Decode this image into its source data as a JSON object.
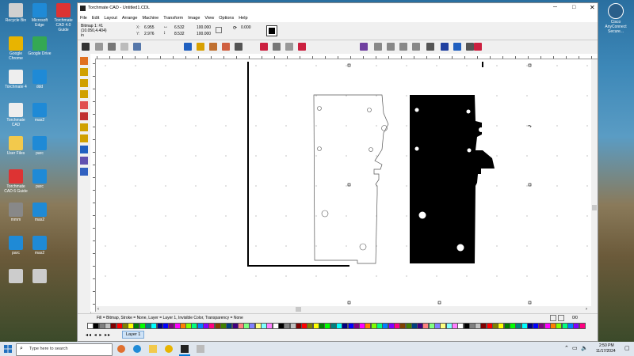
{
  "desktop": {
    "icons": [
      {
        "label": "Recycle Bin",
        "color": "#d0d0d0",
        "col": 0,
        "row": 0
      },
      {
        "label": "Microsoft Edge",
        "color": "#1f8ad6",
        "col": 1,
        "row": 0
      },
      {
        "label": "Torchmate CAD 4.0 Guide",
        "color": "#d33",
        "col": 2,
        "row": 0
      },
      {
        "label": "Google Chrome",
        "color": "#e8b400",
        "col": 0,
        "row": 1
      },
      {
        "label": "Google Drive",
        "color": "#34a853",
        "col": 1,
        "row": 1
      },
      {
        "label": "Torchmate 4",
        "color": "#eee",
        "col": 0,
        "row": 2
      },
      {
        "label": "ddd",
        "color": "#1f8ad6",
        "col": 1,
        "row": 2
      },
      {
        "label": "Torchmate CAD",
        "color": "#eee",
        "col": 0,
        "row": 3
      },
      {
        "label": "mas2",
        "color": "#1f8ad6",
        "col": 1,
        "row": 3
      },
      {
        "label": "User Files",
        "color": "#f2c94c",
        "col": 0,
        "row": 4
      },
      {
        "label": "parc",
        "color": "#1f8ad6",
        "col": 1,
        "row": 4
      },
      {
        "label": "Torchmate CAD 6 Guide",
        "color": "#d33",
        "col": 0,
        "row": 5
      },
      {
        "label": "parc",
        "color": "#1f8ad6",
        "col": 1,
        "row": 5
      },
      {
        "label": "mmm",
        "color": "#888",
        "col": 0,
        "row": 6
      },
      {
        "label": "mas2",
        "color": "#1f8ad6",
        "col": 1,
        "row": 6
      },
      {
        "label": "parc",
        "color": "#1f8ad6",
        "col": 0,
        "row": 7
      },
      {
        "label": "mas2",
        "color": "#1f8ad6",
        "col": 1,
        "row": 7
      },
      {
        "label": "",
        "color": "#ccc",
        "col": 0,
        "row": 8
      },
      {
        "label": "",
        "color": "#ccc",
        "col": 1,
        "row": 8
      }
    ],
    "right_icon_label": "Cisco AnyConnect Secure..."
  },
  "window": {
    "title": "Torchmate CAD - Untitled1.CDL",
    "menu": [
      "File",
      "Edit",
      "Layout",
      "Arrange",
      "Machine",
      "Transform",
      "Image",
      "View",
      "Options",
      "Help"
    ],
    "props": {
      "object": "Bitmap 1: #1",
      "size_readout": "(10.050,4.404)",
      "unit": "in",
      "x_value": "6.955",
      "y_value": "2.976",
      "w_value": "6.532",
      "h_value": "8.532",
      "scale_x": "100.000",
      "scale_y": "100.000",
      "rotation": "0.000"
    },
    "status": "Fill = Bitmap, Stroke = None, Layer = Layer 1, Invisible Color, Transparency = None",
    "layer_tab": "Layer 1",
    "page_indicator": "0/0"
  },
  "taskbar": {
    "search_placeholder": "Type here to search",
    "time": "2:50 PM",
    "date": "11/17/2024"
  },
  "colors": {
    "accent": "#0078d7",
    "window_bg": "#f0f0f0"
  }
}
